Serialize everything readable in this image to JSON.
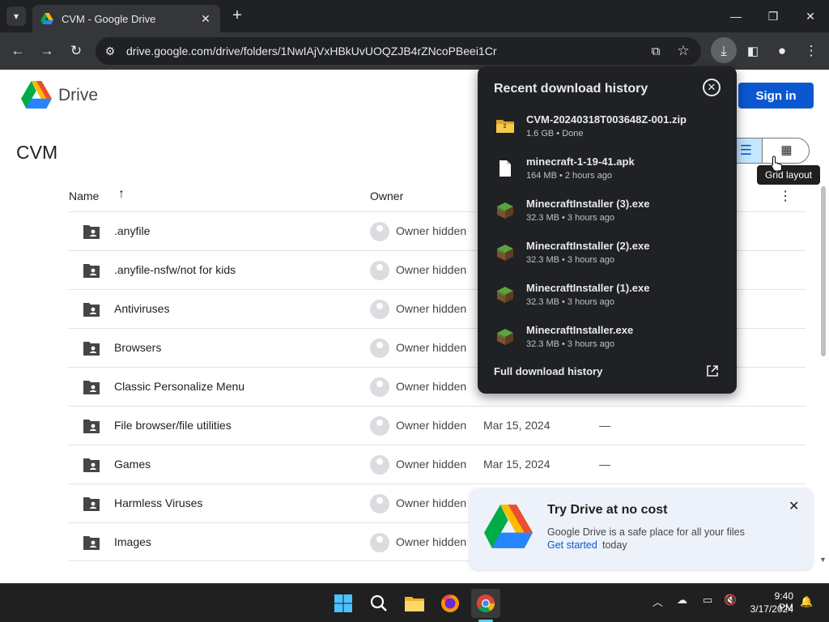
{
  "browser": {
    "tab_title": "CVM - Google Drive",
    "url": "drive.google.com/drive/folders/1NwIAjVxHBkUvUOQZJB4rZNcoPBeei1Cr"
  },
  "drive": {
    "brand": "Drive",
    "sign_in_label": "Sign in",
    "folder_title": "CVM",
    "tooltip": "Grid layout",
    "columns": {
      "name": "Name",
      "owner": "Owner"
    },
    "rows": [
      {
        "name": ".anyfile",
        "owner": "Owner hidden",
        "modified": "",
        "size": ""
      },
      {
        "name": ".anyfile-nsfw/not for kids",
        "owner": "Owner hidden",
        "modified": "",
        "size": ""
      },
      {
        "name": "Antiviruses",
        "owner": "Owner hidden",
        "modified": "",
        "size": ""
      },
      {
        "name": "Browsers",
        "owner": "Owner hidden",
        "modified": "",
        "size": ""
      },
      {
        "name": "Classic Personalize Menu",
        "owner": "Owner hidden",
        "modified": "",
        "size": ""
      },
      {
        "name": "File browser/file utilities",
        "owner": "Owner hidden",
        "modified": "Mar 15, 2024",
        "size": "—"
      },
      {
        "name": "Games",
        "owner": "Owner hidden",
        "modified": "Mar 15, 2024",
        "size": "—"
      },
      {
        "name": "Harmless Viruses",
        "owner": "Owner hidden",
        "modified": "",
        "size": ""
      },
      {
        "name": "Images",
        "owner": "Owner hidden",
        "modified": "",
        "size": ""
      }
    ]
  },
  "downloads": {
    "title": "Recent download history",
    "items": [
      {
        "name": "CVM-20240318T003648Z-001.zip",
        "meta": "1.6 GB • Done",
        "icon": "zip-folder-icon"
      },
      {
        "name": "minecraft-1-19-41.apk",
        "meta": "164 MB • 2 hours ago",
        "icon": "file-icon"
      },
      {
        "name": "MinecraftInstaller (3).exe",
        "meta": "32.3 MB • 3 hours ago",
        "icon": "minecraft-icon"
      },
      {
        "name": "MinecraftInstaller (2).exe",
        "meta": "32.3 MB • 3 hours ago",
        "icon": "minecraft-icon"
      },
      {
        "name": "MinecraftInstaller (1).exe",
        "meta": "32.3 MB • 3 hours ago",
        "icon": "minecraft-icon"
      },
      {
        "name": "MinecraftInstaller.exe",
        "meta": "32.3 MB • 3 hours ago",
        "icon": "minecraft-icon"
      }
    ],
    "full_history_label": "Full download history"
  },
  "promo": {
    "title": "Try Drive at no cost",
    "body": "Google Drive is a safe place for all your files",
    "link": "Get started",
    "tail": "today"
  },
  "taskbar": {
    "time": "9:40 PM",
    "date": "3/17/2024"
  },
  "colors": {
    "accent": "#0b57d0",
    "panel_bg": "#202124",
    "chrome_bg": "#35363a"
  }
}
